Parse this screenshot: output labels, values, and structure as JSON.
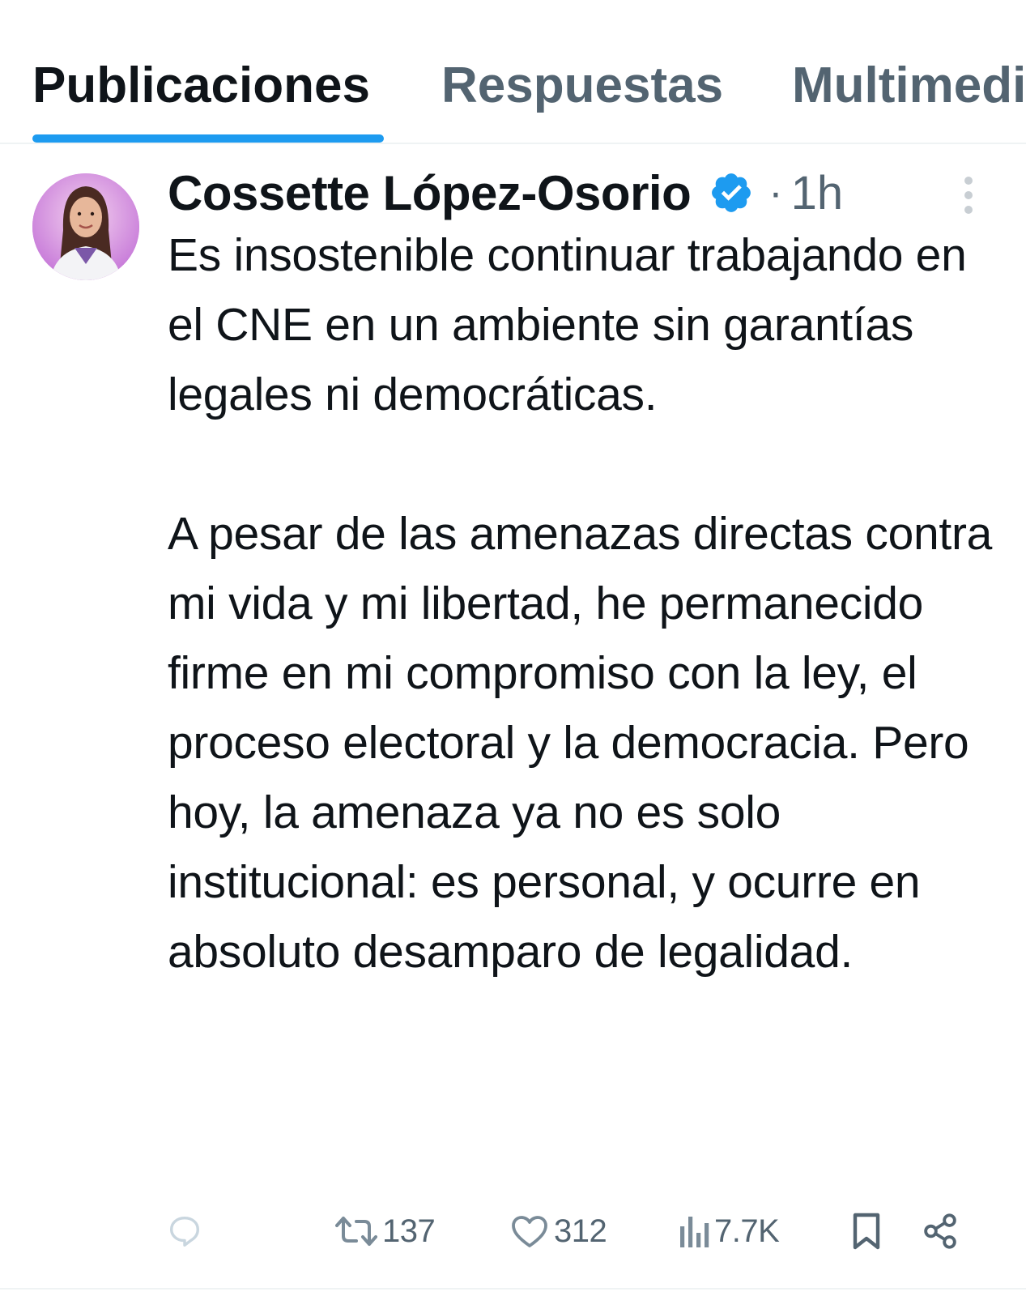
{
  "tabs": [
    {
      "label": "Publicaciones",
      "active": true
    },
    {
      "label": "Respuestas",
      "active": false
    },
    {
      "label": "Multimedia",
      "active": false
    }
  ],
  "post": {
    "author_name": "Cossette López-Osorio",
    "verified": true,
    "separator": "·",
    "timestamp": "1h",
    "text": "Es insostenible continuar trabajando en el CNE en un ambiente sin garantías legales ni democráticas.\n\nA pesar de las amenazas directas contra mi vida y mi libertad, he permanecido firme en mi compromiso con la ley, el proceso electoral y la democracia. Pero hoy, la amenaza ya no es solo institucional: es personal, y ocurre en absoluto desamparo de legalidad.",
    "actions": {
      "reply_icon": "reply-icon",
      "repost_icon": "repost-icon",
      "repost_count": "137",
      "like_icon": "heart-icon",
      "like_count": "312",
      "views_icon": "views-icon",
      "views_count": "7.7K",
      "bookmark_icon": "bookmark-icon",
      "share_icon": "share-icon"
    }
  },
  "colors": {
    "accent": "#1d9bf0",
    "text_primary": "#0f1419",
    "text_secondary": "#536471",
    "divider": "#eff3f4"
  }
}
